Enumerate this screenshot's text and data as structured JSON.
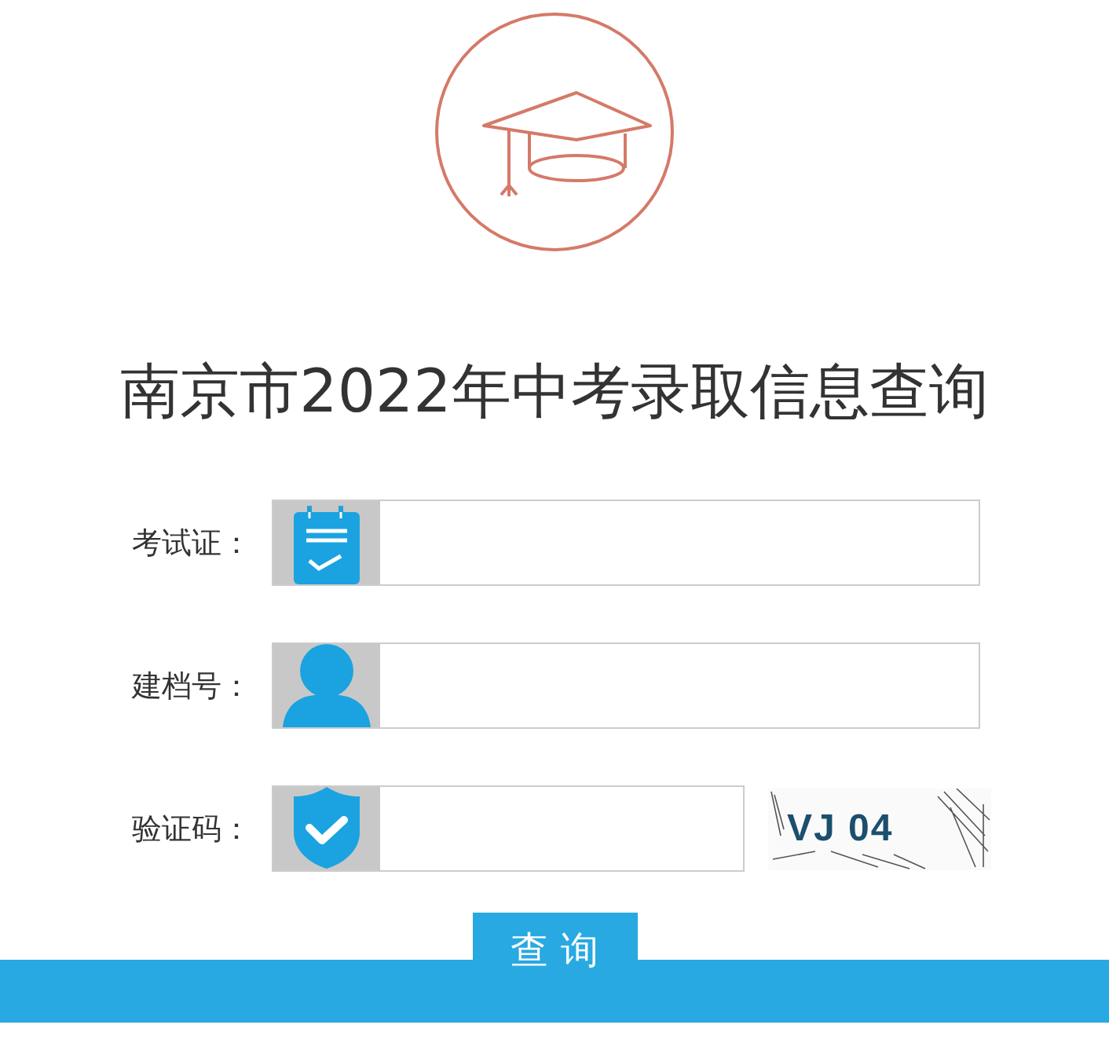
{
  "title": "南京市2022年中考录取信息查询",
  "fields": [
    {
      "label": "考试证：",
      "kind": "clipboard",
      "wide": true
    },
    {
      "label": "建档号：",
      "kind": "person",
      "wide": true
    },
    {
      "label": "验证码：",
      "kind": "shield",
      "wide": false
    }
  ],
  "captcha": {
    "text": "VJ 04"
  },
  "submit_button": "查 询"
}
